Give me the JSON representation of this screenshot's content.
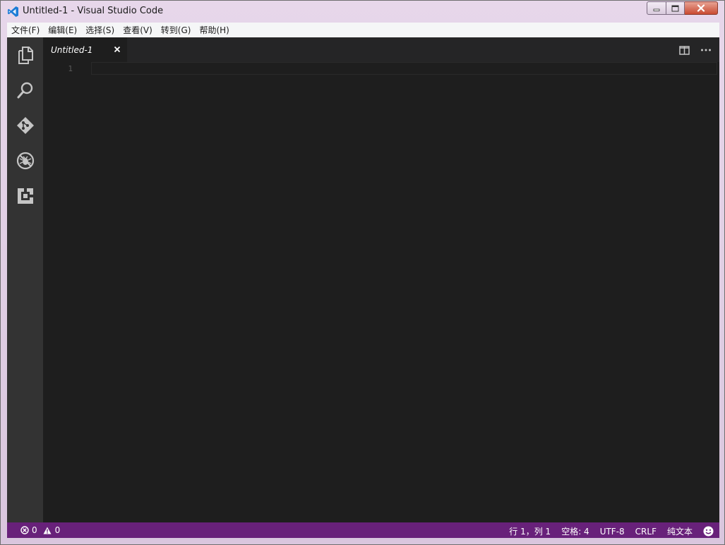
{
  "window": {
    "title": "Untitled-1 - Visual Studio Code",
    "icon": "vscode-logo-icon"
  },
  "menu": [
    "文件(F)",
    "编辑(E)",
    "选择(S)",
    "查看(V)",
    "转到(G)",
    "帮助(H)"
  ],
  "activity_bar": {
    "icons": [
      "files-explorer-icon",
      "search-icon",
      "git-source-control-icon",
      "debug-icon",
      "extensions-icon"
    ]
  },
  "tabs": [
    {
      "label": "Untitled-1",
      "close_icon": "close-icon"
    }
  ],
  "editor_actions": [
    "split-editor-icon",
    "more-actions-icon"
  ],
  "editor": {
    "line_numbers": [
      "1"
    ]
  },
  "status_bar": {
    "errors": "0",
    "warnings": "0",
    "position": "行 1，列 1",
    "indent": "空格: 4",
    "encoding": "UTF-8",
    "eol": "CRLF",
    "language": "纯文本",
    "feedback_icon": "smiley-feedback-icon"
  },
  "colors": {
    "status_bar": "#68217a",
    "activity_bar": "#333333",
    "editor_bg": "#1e1e1e",
    "tab_strip": "#252526",
    "vscode_blue": "#1c7cd6"
  }
}
